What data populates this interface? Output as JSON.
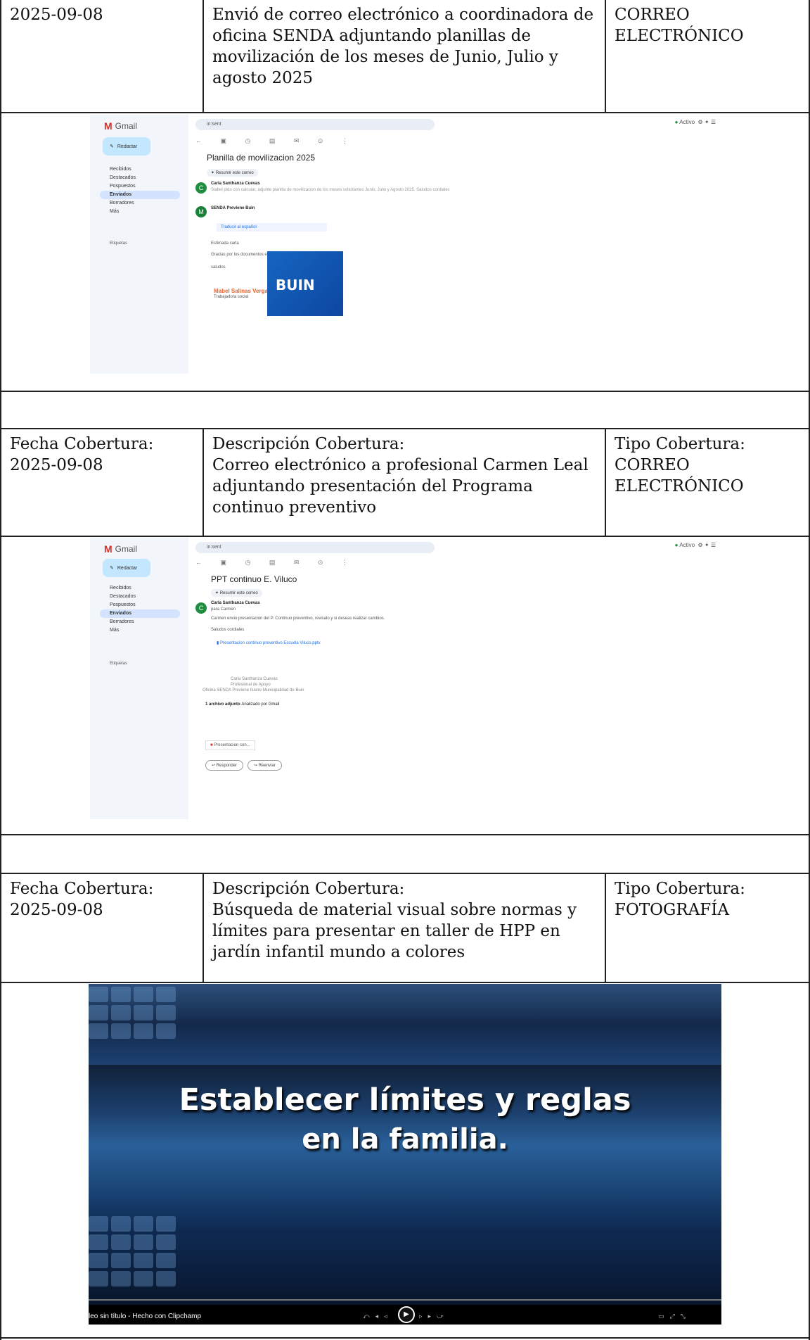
{
  "entries": [
    {
      "date_label": "",
      "date": "2025-09-08",
      "desc_label": "",
      "description": "Envió de correo electrónico a coordinadora de oficina SENDA adjuntando planillas de movilización de los meses de Junio, Julio y agosto 2025",
      "type_label": "",
      "type": "CORREO ELECTRÓNICO"
    },
    {
      "date_label": "Fecha Cobertura:",
      "date": "2025-09-08",
      "desc_label": "Descripción Cobertura:",
      "description": "Correo electrónico a profesional Carmen Leal adjuntando presentación del Programa continuo preventivo",
      "type_label": "Tipo Cobertura:",
      "type": "CORREO ELECTRÓNICO"
    },
    {
      "date_label": "Fecha Cobertura:",
      "date": "2025-09-08",
      "desc_label": "Descripción Cobertura:",
      "description": "Búsqueda de material visual sobre normas y límites para presentar en taller de HPP en jardín infantil mundo a colores",
      "type_label": "Tipo Cobertura:",
      "type": "FOTOGRAFÍA"
    }
  ],
  "gmail1": {
    "app": "Gmail",
    "search": "in:sent",
    "compose": "Redactar",
    "nav": [
      "Recibidos",
      "Destacados",
      "Pospuestos",
      "Enviados",
      "Borradores",
      "Más"
    ],
    "labels": "Etiquetas",
    "subject": "Planilla de movilizacion 2025",
    "summary": "Resumir este correo",
    "sender1": "Carla Santhanza Cuevas",
    "snippet1": "Slabel pido con calcular, adjunte planilla de movilizacion de los meses solicitantes Junio, Julio y Agosto 2025. Saludos cordiales",
    "sender2": "SENDA Previene Buin",
    "translate": "Traducir al español",
    "greeting": "Estimada carla",
    "body": "Gracias por los documentos enviados. los revisare a la brevedad",
    "closing": "saludos",
    "sig_name": "Mabel Salinas Vergara",
    "sig_role": "Trabajadora social",
    "brand": "BUIN",
    "status": "Activo"
  },
  "gmail2": {
    "app": "Gmail",
    "search": "in:sent",
    "compose": "Redactar",
    "nav": [
      "Recibidos",
      "Destacados",
      "Pospuestos",
      "Enviados",
      "Borradores",
      "Más"
    ],
    "labels": "Etiquetas",
    "subject": "PPT continuo E. Viluco",
    "summary": "Resumir este correo",
    "sender1": "Carla Santhanza Cuevas",
    "to": "para Carmen",
    "body": "Carmen envio presentacion del P. Continuo preventivo, revisalo y si deseas realizar cambios.",
    "regards": "Saludos cordiales",
    "attachment": "Presentacion continuo preventivo Escuela Viluco.pptx",
    "sig1": "Carla Santhanza Cuevas",
    "sig2": "Profesional de Apoyo",
    "sig3": "Oficina SENDA Previene Ilustre Municipalidad de Buin",
    "attach_count": "1 archivo adjunto",
    "scanned": "Analizado por Gmail",
    "file_chip": "Presentacion con...",
    "reply": "Responder",
    "forward": "Reenviar",
    "status": "Activo"
  },
  "video": {
    "title_line1": "Establecer límites y reglas",
    "title_line2": "en la familia.",
    "caption": "leo sin título - Hecho con Clipchamp"
  }
}
